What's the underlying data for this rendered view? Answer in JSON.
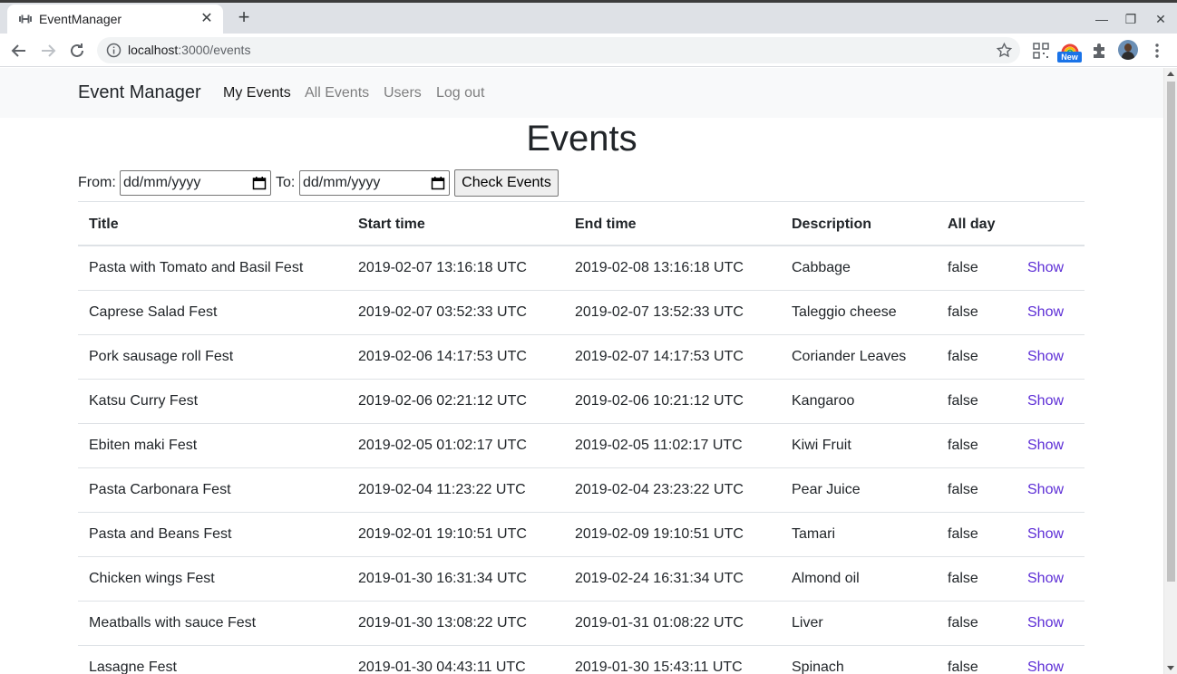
{
  "browser": {
    "tab_title": "EventManager",
    "url_host": "localhost",
    "url_path": ":3000/events",
    "new_badge": "New"
  },
  "navbar": {
    "brand": "Event Manager",
    "links": [
      {
        "label": "My Events",
        "active": true
      },
      {
        "label": "All Events",
        "active": false
      },
      {
        "label": "Users",
        "active": false
      },
      {
        "label": "Log out",
        "active": false
      }
    ]
  },
  "page": {
    "title": "Events",
    "filter": {
      "from_label": "From:",
      "from_placeholder": "dd/mm/yyyy",
      "to_label": "To:",
      "to_placeholder": "dd/mm/yyyy",
      "button": "Check Events"
    }
  },
  "table": {
    "headers": [
      "Title",
      "Start time",
      "End time",
      "Description",
      "All day",
      ""
    ],
    "rows": [
      [
        "Pasta with Tomato and Basil Fest",
        "2019-02-07 13:16:18 UTC",
        "2019-02-08 13:16:18 UTC",
        "Cabbage",
        "false",
        "Show"
      ],
      [
        "Caprese Salad Fest",
        "2019-02-07 03:52:33 UTC",
        "2019-02-07 13:52:33 UTC",
        "Taleggio cheese",
        "false",
        "Show"
      ],
      [
        "Pork sausage roll Fest",
        "2019-02-06 14:17:53 UTC",
        "2019-02-07 14:17:53 UTC",
        "Coriander Leaves",
        "false",
        "Show"
      ],
      [
        "Katsu Curry Fest",
        "2019-02-06 02:21:12 UTC",
        "2019-02-06 10:21:12 UTC",
        "Kangaroo",
        "false",
        "Show"
      ],
      [
        "Ebiten maki Fest",
        "2019-02-05 01:02:17 UTC",
        "2019-02-05 11:02:17 UTC",
        "Kiwi Fruit",
        "false",
        "Show"
      ],
      [
        "Pasta Carbonara Fest",
        "2019-02-04 11:23:22 UTC",
        "2019-02-04 23:23:22 UTC",
        "Pear Juice",
        "false",
        "Show"
      ],
      [
        "Pasta and Beans Fest",
        "2019-02-01 19:10:51 UTC",
        "2019-02-09 19:10:51 UTC",
        "Tamari",
        "false",
        "Show"
      ],
      [
        "Chicken wings Fest",
        "2019-01-30 16:31:34 UTC",
        "2019-02-24 16:31:34 UTC",
        "Almond oil",
        "false",
        "Show"
      ],
      [
        "Meatballs with sauce Fest",
        "2019-01-30 13:08:22 UTC",
        "2019-01-31 01:08:22 UTC",
        "Liver",
        "false",
        "Show"
      ],
      [
        "Lasagne Fest",
        "2019-01-30 04:43:11 UTC",
        "2019-01-30 15:43:11 UTC",
        "Spinach",
        "false",
        "Show"
      ]
    ]
  },
  "colors": {
    "link": "#5d2ed6",
    "navbar_bg": "#f8f9fa",
    "border": "#dee2e6"
  }
}
